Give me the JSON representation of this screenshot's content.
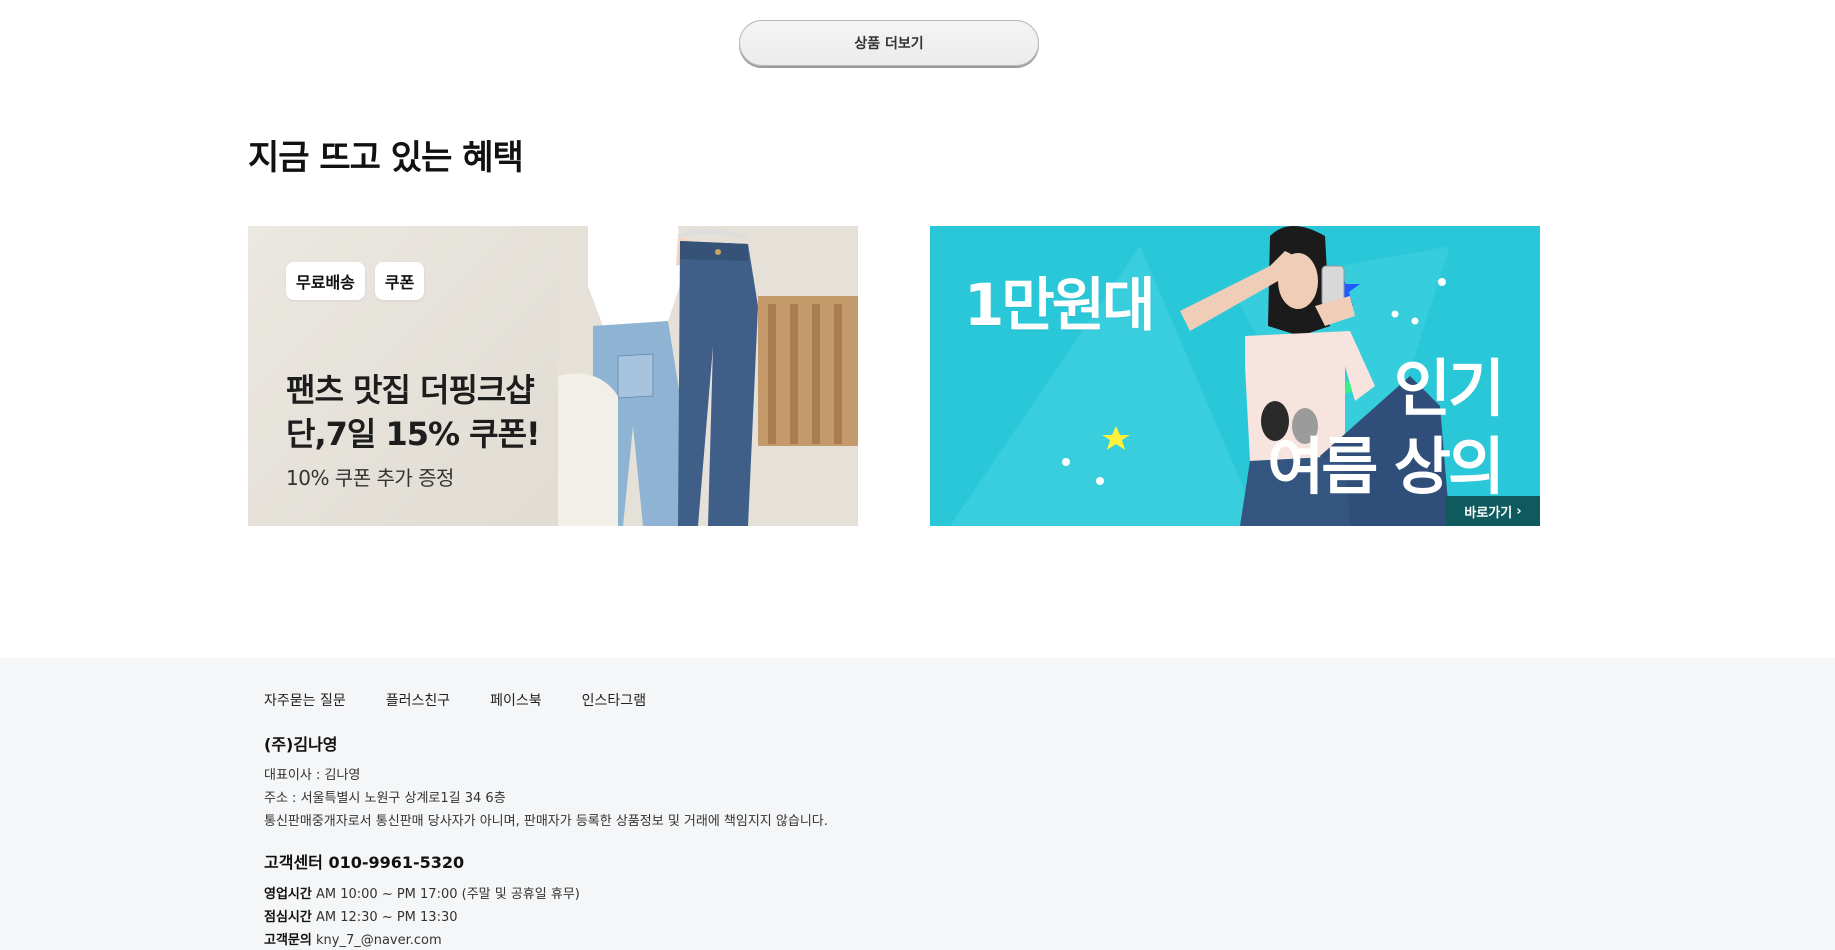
{
  "more_button": {
    "label": "상품 더보기"
  },
  "section": {
    "title": "지금 뜨고 있는 혜택"
  },
  "banners": [
    {
      "tags": [
        "무료배송",
        "쿠폰"
      ],
      "headline": "팬츠 맛집 더핑크샵\n단,7일 15% 쿠폰!",
      "sub": "10% 쿠폰 추가 증정"
    },
    {
      "price_text": "1만원대",
      "title_line1": "인기",
      "title_line2": "여름 상의",
      "cta": "바로가기"
    }
  ],
  "footer": {
    "links": [
      "자주묻는 질문",
      "플러스친구",
      "페이스북",
      "인스타그램"
    ],
    "company": {
      "name": "(주)김나영",
      "ceo": "대표이사 : 김나영",
      "address": "주소 : 서울특별시 노원구 상계로1길 34 6층",
      "notice": "통신판매중개자로서 통신판매 당사자가 아니며, 판매자가 등록한 상품정보 및 거래에 책임지지 않습니다."
    },
    "cs": {
      "title": "고객센터 010-9961-5320",
      "hours_label": "영업시간",
      "hours": "AM 10:00 ~ PM 17:00 (주말 및 공휴일 휴무)",
      "lunch_label": "점심시간",
      "lunch": "AM 12:30 ~ PM 13:30",
      "inquiry_label": "고객문의",
      "email": "kny_7_@naver.com"
    }
  },
  "colors": {
    "banner2_bg": "#29c7d8",
    "banner2_cta": "#0e5a5e",
    "footer_bg": "#f5f6f7"
  }
}
